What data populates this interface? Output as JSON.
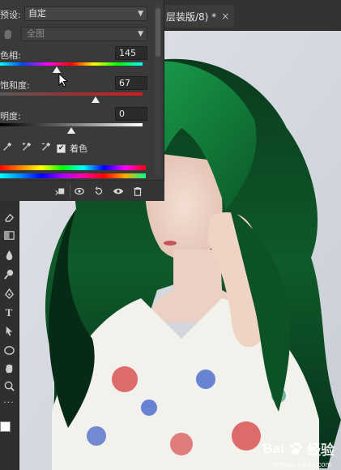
{
  "document": {
    "tab_title": "层装版/8) *",
    "close_glyph": "×"
  },
  "panel": {
    "preset_label": "预设:",
    "preset_value": "自定",
    "channel_value": "全图",
    "hue": {
      "label": "色相:",
      "value": "145",
      "fraction": 0.4
    },
    "saturation": {
      "label": "饱和度:",
      "value": "67",
      "fraction": 0.67
    },
    "lightness": {
      "label": "明度:",
      "value": "0",
      "fraction": 0.5
    },
    "colorize_label": "着色",
    "colorize_checked": true,
    "checkmark": "✔"
  },
  "toolbar": {
    "tools": [
      "eraser-icon",
      "gradient-icon",
      "blur-icon",
      "dodge-icon",
      "pen-icon",
      "type-icon",
      "path-select-icon",
      "ellipse-icon",
      "hand-icon",
      "zoom-icon",
      "more-icon"
    ],
    "type_glyph": "T",
    "more_glyph": "···"
  },
  "colors": {
    "foreground": "#ffffff",
    "background": "#000000",
    "hair": "#0d4a24",
    "accent_hair": "#1f8a44"
  },
  "watermark": {
    "brand_prefix": "Bai",
    "brand_suffix": "经验",
    "url": "jingyan.baidu.com"
  }
}
